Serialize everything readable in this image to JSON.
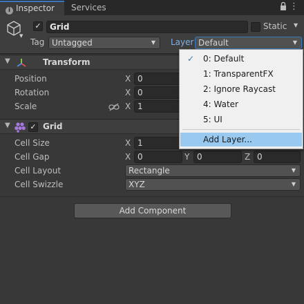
{
  "tabs": {
    "inspector": "Inspector",
    "services": "Services"
  },
  "header": {
    "active": true,
    "name": "Grid",
    "static_label": "Static",
    "static_checked": false,
    "tag_label": "Tag",
    "tag_value": "Untagged",
    "layer_label": "Layer",
    "layer_value": "Default"
  },
  "transform": {
    "title": "Transform",
    "position": {
      "label": "Position",
      "x_label": "X",
      "x": "0"
    },
    "rotation": {
      "label": "Rotation",
      "x_label": "X",
      "x": "0"
    },
    "scale": {
      "label": "Scale",
      "x_label": "X",
      "x": "1"
    }
  },
  "grid": {
    "title": "Grid",
    "enabled": true,
    "cell_size": {
      "label": "Cell Size",
      "x_label": "X",
      "x": "1"
    },
    "cell_gap": {
      "label": "Cell Gap",
      "x_label": "X",
      "x": "0",
      "y_label": "Y",
      "y": "0",
      "z_label": "Z",
      "z": "0"
    },
    "cell_layout": {
      "label": "Cell Layout",
      "value": "Rectangle"
    },
    "cell_swizzle": {
      "label": "Cell Swizzle",
      "value": "XYZ"
    }
  },
  "add_component": "Add Component",
  "layer_menu": {
    "items": [
      "0: Default",
      "1: TransparentFX",
      "2: Ignore Raycast",
      "4: Water",
      "5: UI"
    ],
    "checked_index": 0,
    "add_layer": "Add Layer..."
  },
  "colors": {
    "accent": "#3a79bb",
    "menu_highlight": "#99c9ef",
    "background": "#383838"
  }
}
